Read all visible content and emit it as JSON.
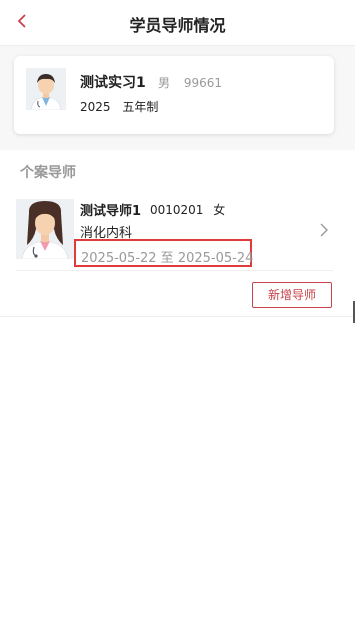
{
  "header": {
    "title": "学员导师情况",
    "back_icon": "chevron-left-icon"
  },
  "student": {
    "name": "测试实习1",
    "gender": "男",
    "id": "99661",
    "year": "2025",
    "program": "五年制",
    "avatar_icon": "male-doctor-avatar"
  },
  "section": {
    "title": "个案导师"
  },
  "mentor": {
    "name": "测试导师1",
    "id": "0010201",
    "gender": "女",
    "department": "消化内科",
    "date_range": "2025-05-22 至 2025-05-24",
    "avatar_icon": "female-doctor-avatar",
    "chevron_icon": "chevron-right-icon"
  },
  "actions": {
    "add_mentor_label": "新增导师"
  },
  "colors": {
    "accent": "#c9424a",
    "highlight": "#e03a3a"
  }
}
